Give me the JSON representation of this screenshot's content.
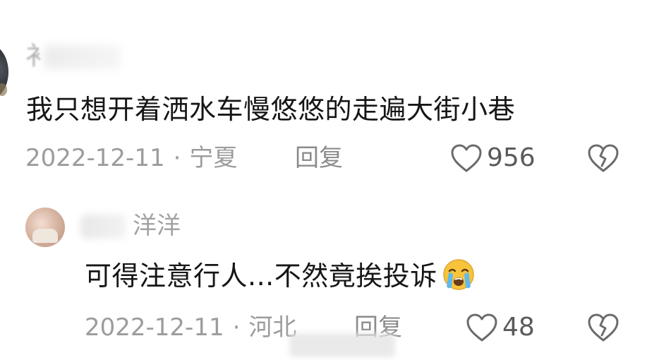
{
  "main_comment": {
    "username_visible": "衤",
    "text": "我只想开着洒水车慢悠悠的走遍大街小巷",
    "date": "2022-12-11",
    "separator": "·",
    "location": "宁夏",
    "reply_label": "回复",
    "like_count": "956"
  },
  "reply_comment": {
    "username_visible": "洋洋",
    "text": "可得注意行人...不然竟挨投诉",
    "date": "2022-12-11",
    "separator": "·",
    "location": "河北",
    "reply_label": "回复",
    "like_count": "48"
  },
  "icons": {
    "like": "heart-outline-icon",
    "dislike": "broken-heart-icon",
    "emoji": "loudly-crying-face-emoji"
  },
  "colors": {
    "text": "#161616",
    "meta": "#9c9c9c",
    "icon": "#6b6b6b"
  }
}
